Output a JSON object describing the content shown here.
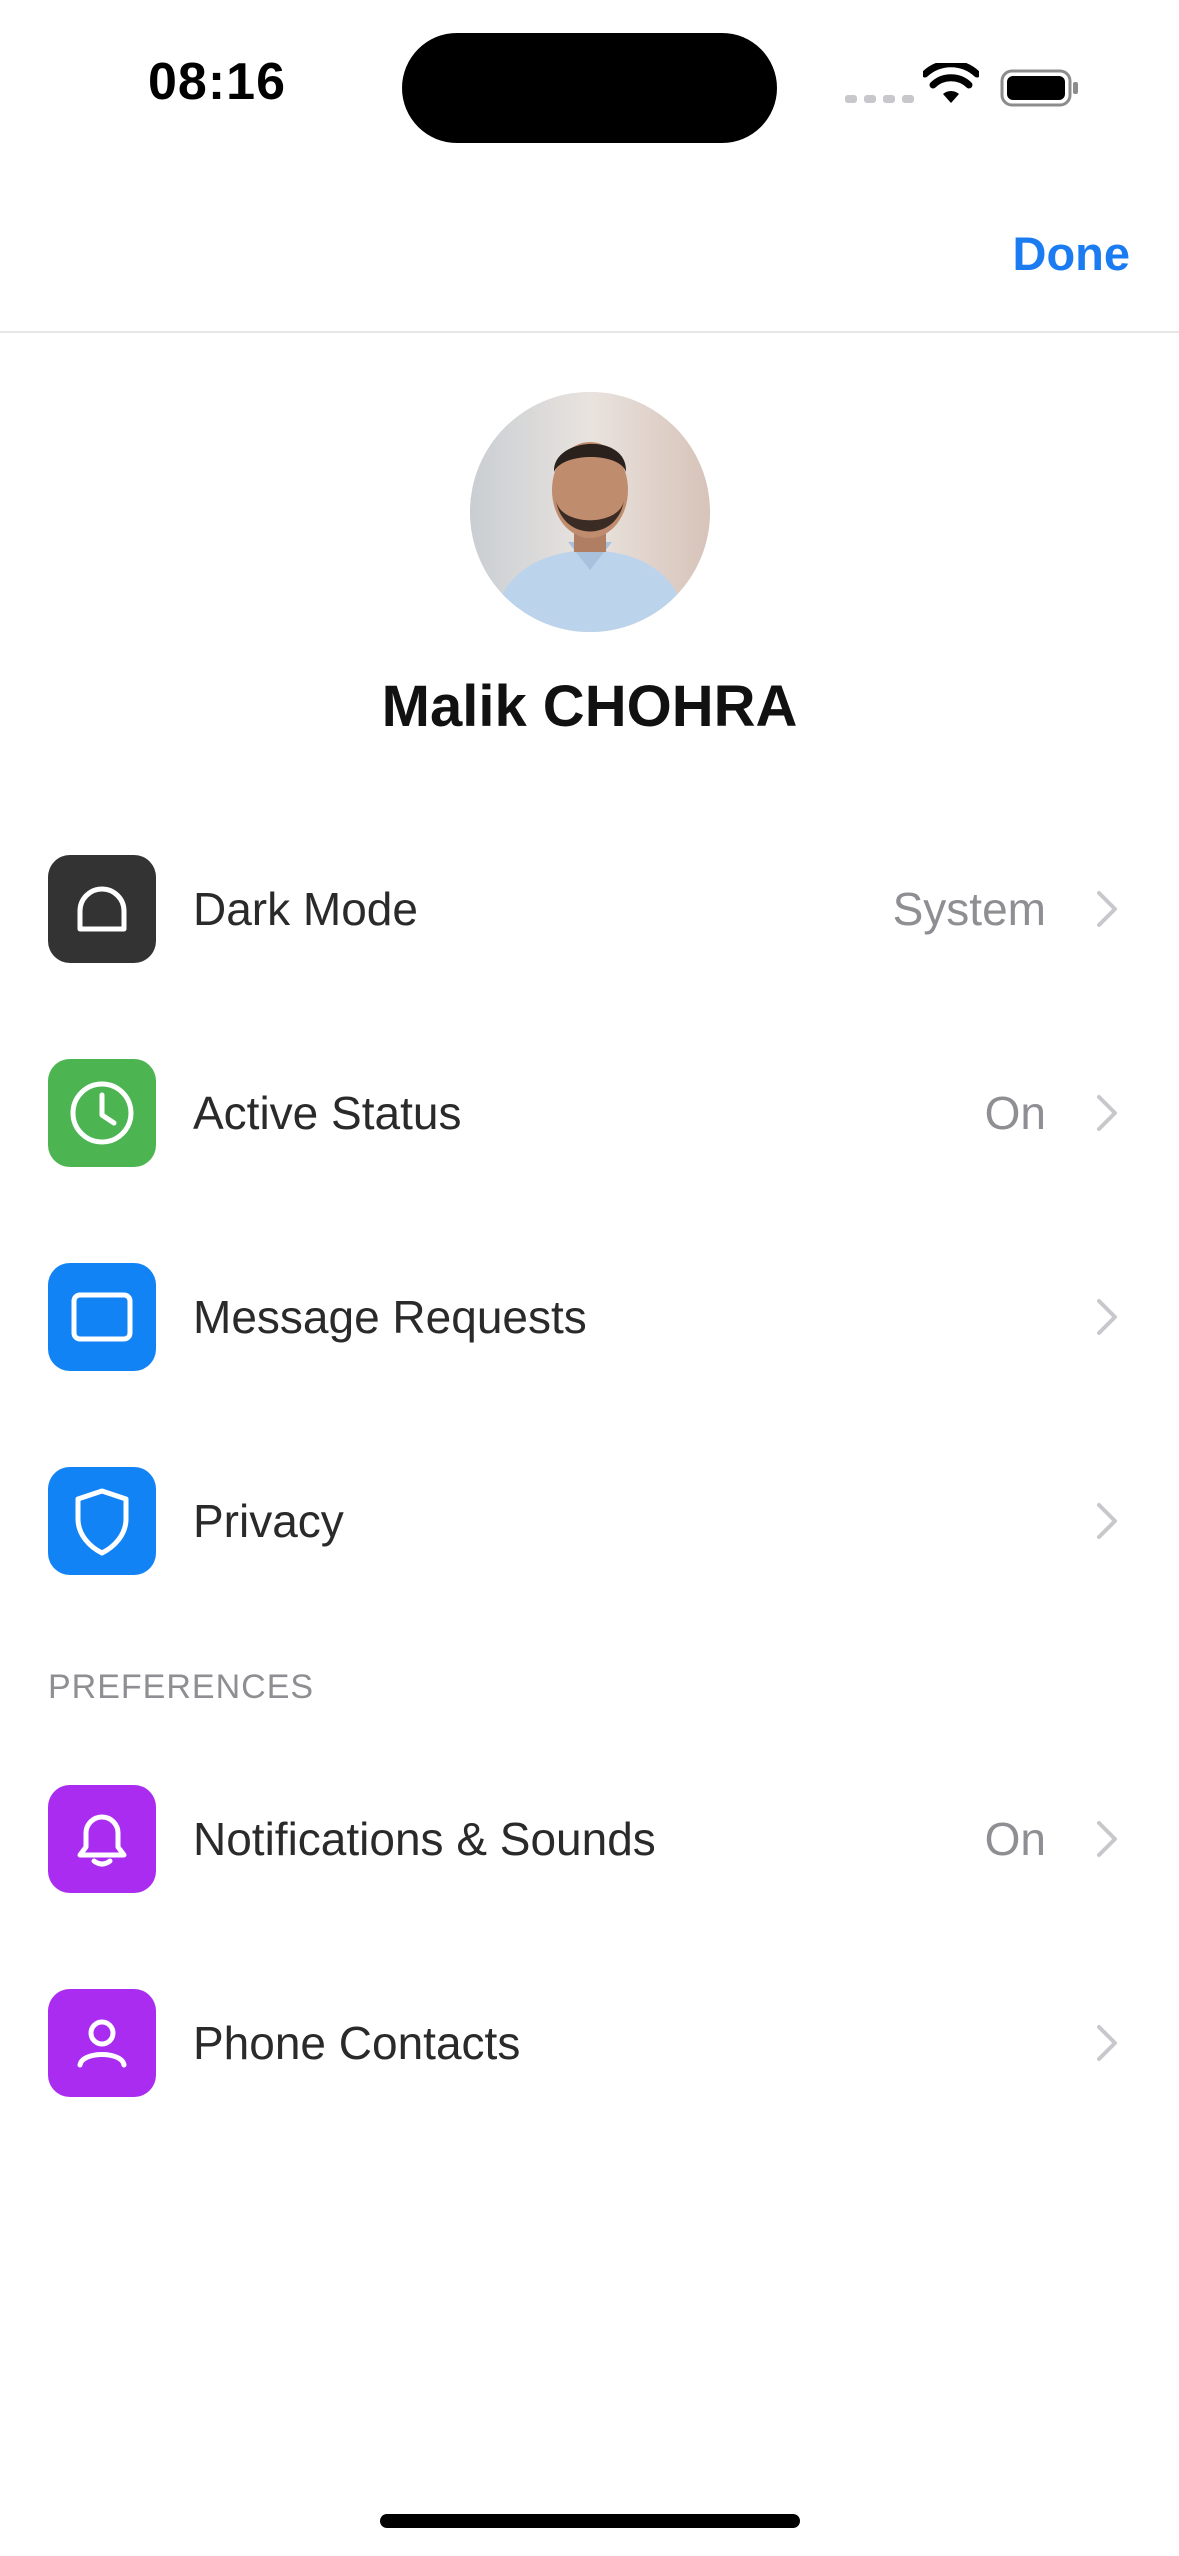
{
  "status_bar": {
    "time": "08:16"
  },
  "nav": {
    "done_label": "Done"
  },
  "profile": {
    "name": "Malik CHOHRA"
  },
  "settings": [
    {
      "icon": "dark-mode-icon",
      "label": "Dark Mode",
      "value": "System",
      "color": "#333333"
    },
    {
      "icon": "clock-icon",
      "label": "Active Status",
      "value": "On",
      "color": "#4cb552"
    },
    {
      "icon": "message-icon",
      "label": "Message Requests",
      "value": "",
      "color": "#1283f5"
    },
    {
      "icon": "shield-icon",
      "label": "Privacy",
      "value": "",
      "color": "#1283f5"
    }
  ],
  "preferences": {
    "header": "PREFERENCES",
    "items": [
      {
        "icon": "bell-icon",
        "label": "Notifications & Sounds",
        "value": "On",
        "color": "#a92cf0"
      },
      {
        "icon": "person-icon",
        "label": "Phone Contacts",
        "value": "",
        "color": "#a92cf0"
      }
    ]
  }
}
